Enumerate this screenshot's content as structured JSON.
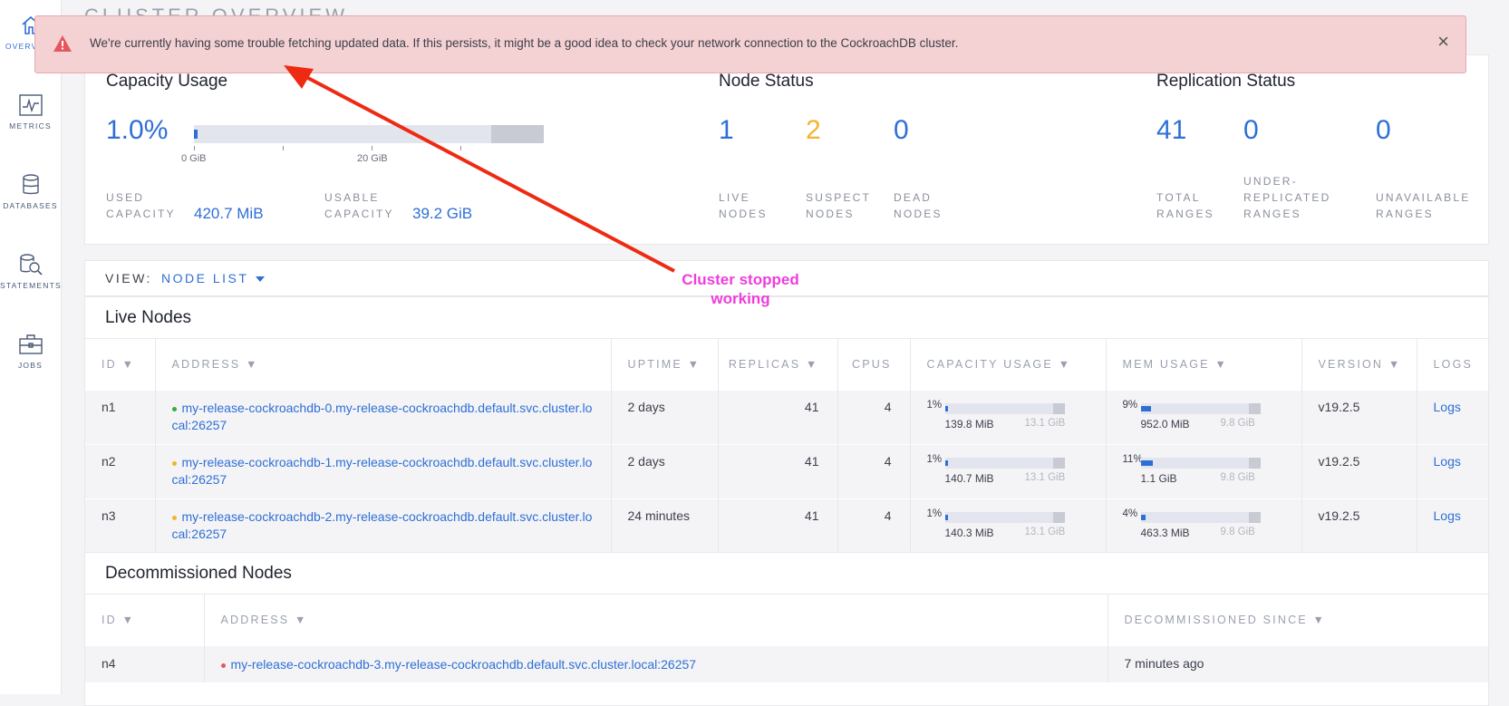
{
  "page": {
    "title": "CLUSTER OVERVIEW"
  },
  "sidebar": {
    "items": [
      {
        "label": "OVERVIEW",
        "icon": "home-icon",
        "active": true
      },
      {
        "label": "METRICS",
        "icon": "chart-icon",
        "active": false
      },
      {
        "label": "DATABASES",
        "icon": "database-icon",
        "active": false
      },
      {
        "label": "STATEMENTS",
        "icon": "statements-icon",
        "active": false
      },
      {
        "label": "JOBS",
        "icon": "briefcase-icon",
        "active": false
      }
    ]
  },
  "alert": {
    "text": "We're currently having some trouble fetching updated data. If this persists, it might be a good idea to check your network connection to the CockroachDB cluster.",
    "close": "×",
    "color": "#f4d1d3"
  },
  "capacity": {
    "title": "Capacity Usage",
    "percent": "1.0%",
    "tick0": "0 GiB",
    "tick20": "20 GiB",
    "used_label": [
      "USED",
      "CAPACITY"
    ],
    "used_value": "420.7 MiB",
    "usable_label": [
      "USABLE",
      "CAPACITY"
    ],
    "usable_value": "39.2 GiB"
  },
  "node_status": {
    "title": "Node Status",
    "live": "1",
    "live_label": [
      "LIVE",
      "NODES"
    ],
    "suspect": "2",
    "suspect_label": [
      "SUSPECT",
      "NODES"
    ],
    "dead": "0",
    "dead_label": [
      "DEAD",
      "NODES"
    ]
  },
  "replication": {
    "title": "Replication Status",
    "total": "41",
    "total_label": [
      "TOTAL",
      "RANGES"
    ],
    "under": "0",
    "under_label": [
      "UNDER-",
      "REPLICATED",
      "RANGES"
    ],
    "unavailable": "0",
    "unavailable_label": [
      "UNAVAILABLE",
      "RANGES"
    ]
  },
  "view": {
    "label": "VIEW:",
    "value": "NODE LIST"
  },
  "live_nodes": {
    "title": "Live Nodes",
    "columns": [
      "ID ▼",
      "ADDRESS ▼",
      "UPTIME ▼",
      "REPLICAS ▼",
      "CPUS",
      "CAPACITY USAGE ▼",
      "MEM USAGE ▼",
      "VERSION ▼",
      "LOGS"
    ],
    "rows": [
      {
        "id": "n1",
        "status": "live",
        "address": "my-release-cockroachdb-0.my-release-cockroachdb.default.svc.cluster.local:26257",
        "uptime": "2 days",
        "replicas": "41",
        "cpus": "4",
        "cap_pct": "1%",
        "cap_fraction": 0.01,
        "cap_used": "139.8 MiB",
        "cap_total": "13.1 GiB",
        "mem_pct": "9%",
        "mem_fraction": 0.09,
        "mem_used": "952.0 MiB",
        "mem_total": "9.8 GiB",
        "version": "v19.2.5",
        "logs": "Logs"
      },
      {
        "id": "n2",
        "status": "suspect",
        "address": "my-release-cockroachdb-1.my-release-cockroachdb.default.svc.cluster.local:26257",
        "uptime": "2 days",
        "replicas": "41",
        "cpus": "4",
        "cap_pct": "1%",
        "cap_fraction": 0.01,
        "cap_used": "140.7 MiB",
        "cap_total": "13.1 GiB",
        "mem_pct": "11%",
        "mem_fraction": 0.11,
        "mem_used": "1.1 GiB",
        "mem_total": "9.8 GiB",
        "version": "v19.2.5",
        "logs": "Logs"
      },
      {
        "id": "n3",
        "status": "suspect",
        "address": "my-release-cockroachdb-2.my-release-cockroachdb.default.svc.cluster.local:26257",
        "uptime": "24 minutes",
        "replicas": "41",
        "cpus": "4",
        "cap_pct": "1%",
        "cap_fraction": 0.01,
        "cap_used": "140.3 MiB",
        "cap_total": "13.1 GiB",
        "mem_pct": "4%",
        "mem_fraction": 0.04,
        "mem_used": "463.3 MiB",
        "mem_total": "9.8 GiB",
        "version": "v19.2.5",
        "logs": "Logs"
      }
    ]
  },
  "decommissioned": {
    "title": "Decommissioned Nodes",
    "columns": [
      "ID ▼",
      "ADDRESS ▼",
      "DECOMMISSIONED SINCE ▼"
    ],
    "rows": [
      {
        "id": "n4",
        "address": "my-release-cockroachdb-3.my-release-cockroachdb.default.svc.cluster.local:26257",
        "since": "7 minutes ago"
      }
    ]
  },
  "annotation": {
    "line1": "Cluster stopped",
    "line2": "working",
    "color": "#f03cde",
    "arrow_color": "#ee2a12"
  },
  "colors": {
    "live": "#3aa843",
    "suspect": "#f2b42c",
    "dead": "#e5575e",
    "accent": "#2e6fd6"
  }
}
